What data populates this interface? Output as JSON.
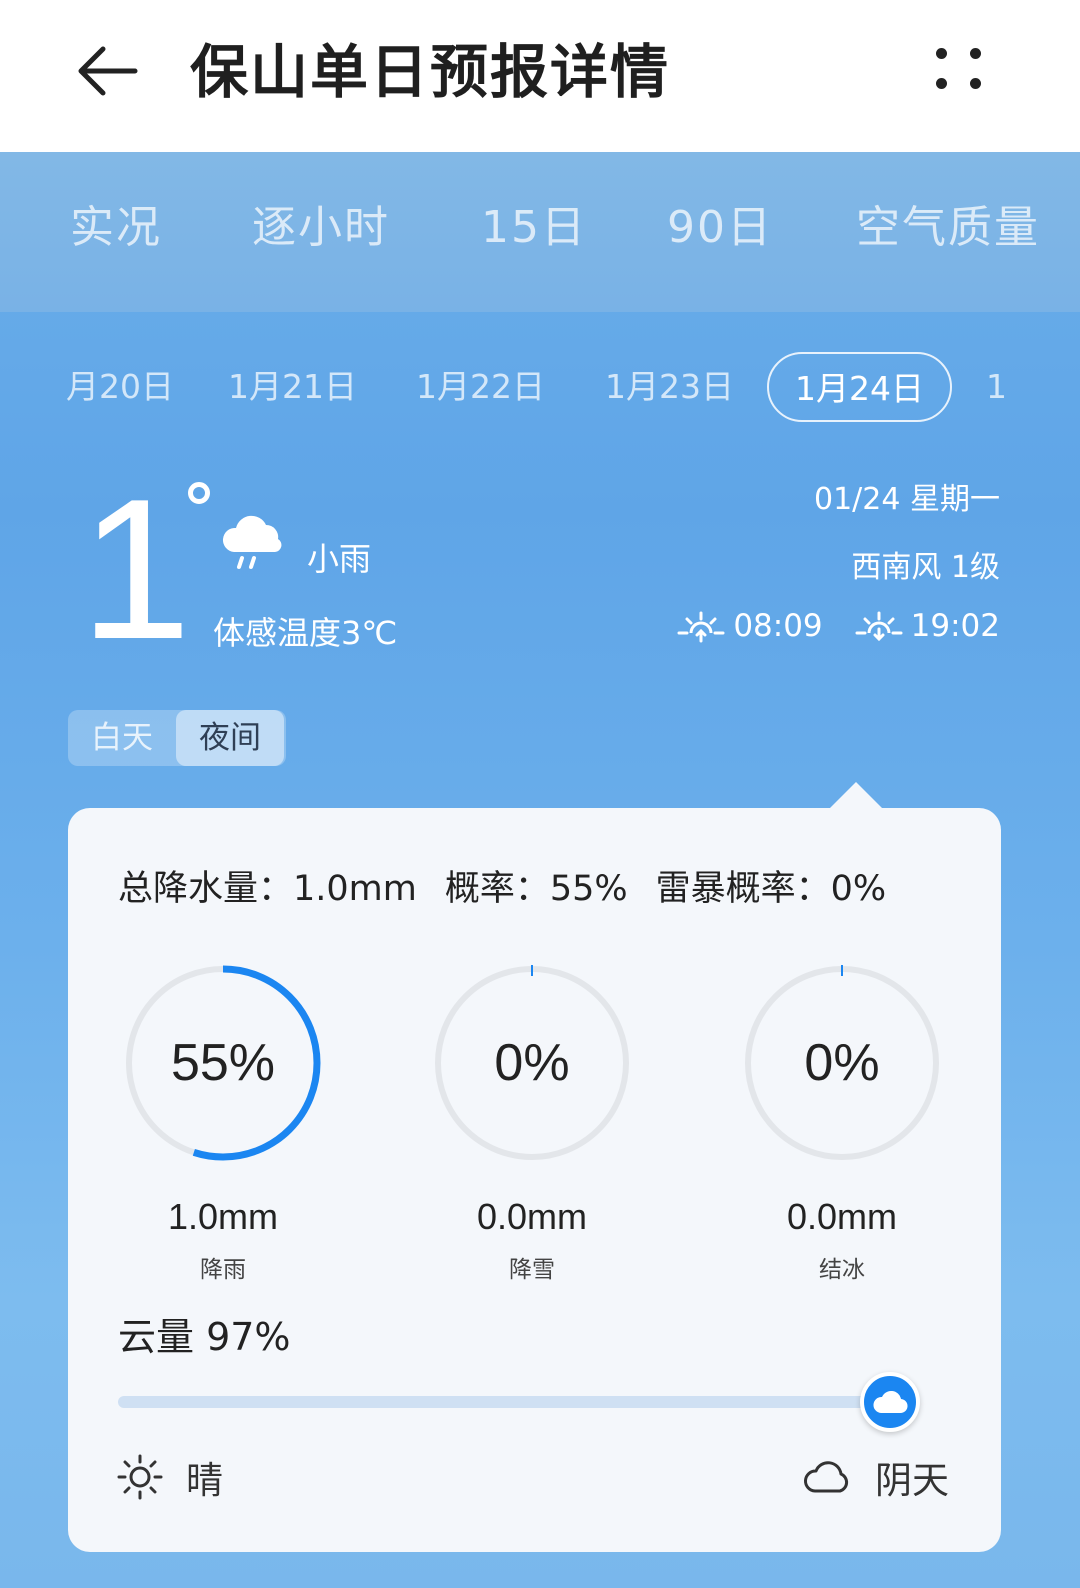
{
  "header": {
    "title": "保山单日预报详情",
    "back_icon": "arrow-left-icon",
    "more_icon": "more-dots-icon"
  },
  "tabs": [
    "实况",
    "逐小时",
    "15日",
    "90日",
    "空气质量"
  ],
  "dates": {
    "items": [
      "月20日",
      "1月21日",
      "1月22日",
      "1月23日",
      "1月24日",
      "1"
    ],
    "selected": "1月24日"
  },
  "current": {
    "temperature": "1",
    "condition": "小雨",
    "condition_icon": "light-rain-cloud-icon",
    "feels_like": "体感温度3℃",
    "date": "01/24 星期一",
    "wind": "西南风 1级",
    "sunrise": "08:09",
    "sunset": "19:02"
  },
  "segment": {
    "day": "白天",
    "night": "夜间",
    "selected": "夜间"
  },
  "precip": {
    "summary_total": "总降水量：1.0mm",
    "summary_prob": "概率：55%",
    "summary_thunder": "雷暴概率：0%",
    "rings": [
      {
        "percent_label": "55%",
        "value": 0.55,
        "amount": "1.0mm",
        "kind": "降雨"
      },
      {
        "percent_label": "0%",
        "value": 0,
        "amount": "0.0mm",
        "kind": "降雪"
      },
      {
        "percent_label": "0%",
        "value": 0,
        "amount": "0.0mm",
        "kind": "结冰"
      }
    ]
  },
  "cloud": {
    "label": "云量 97%",
    "value": 0.97,
    "clear_label": "晴",
    "cloudy_label": "阴天"
  },
  "colors": {
    "accent": "#1b86f1",
    "ring_track": "#e3e6ea",
    "card_bg": "#f4f7fb"
  }
}
